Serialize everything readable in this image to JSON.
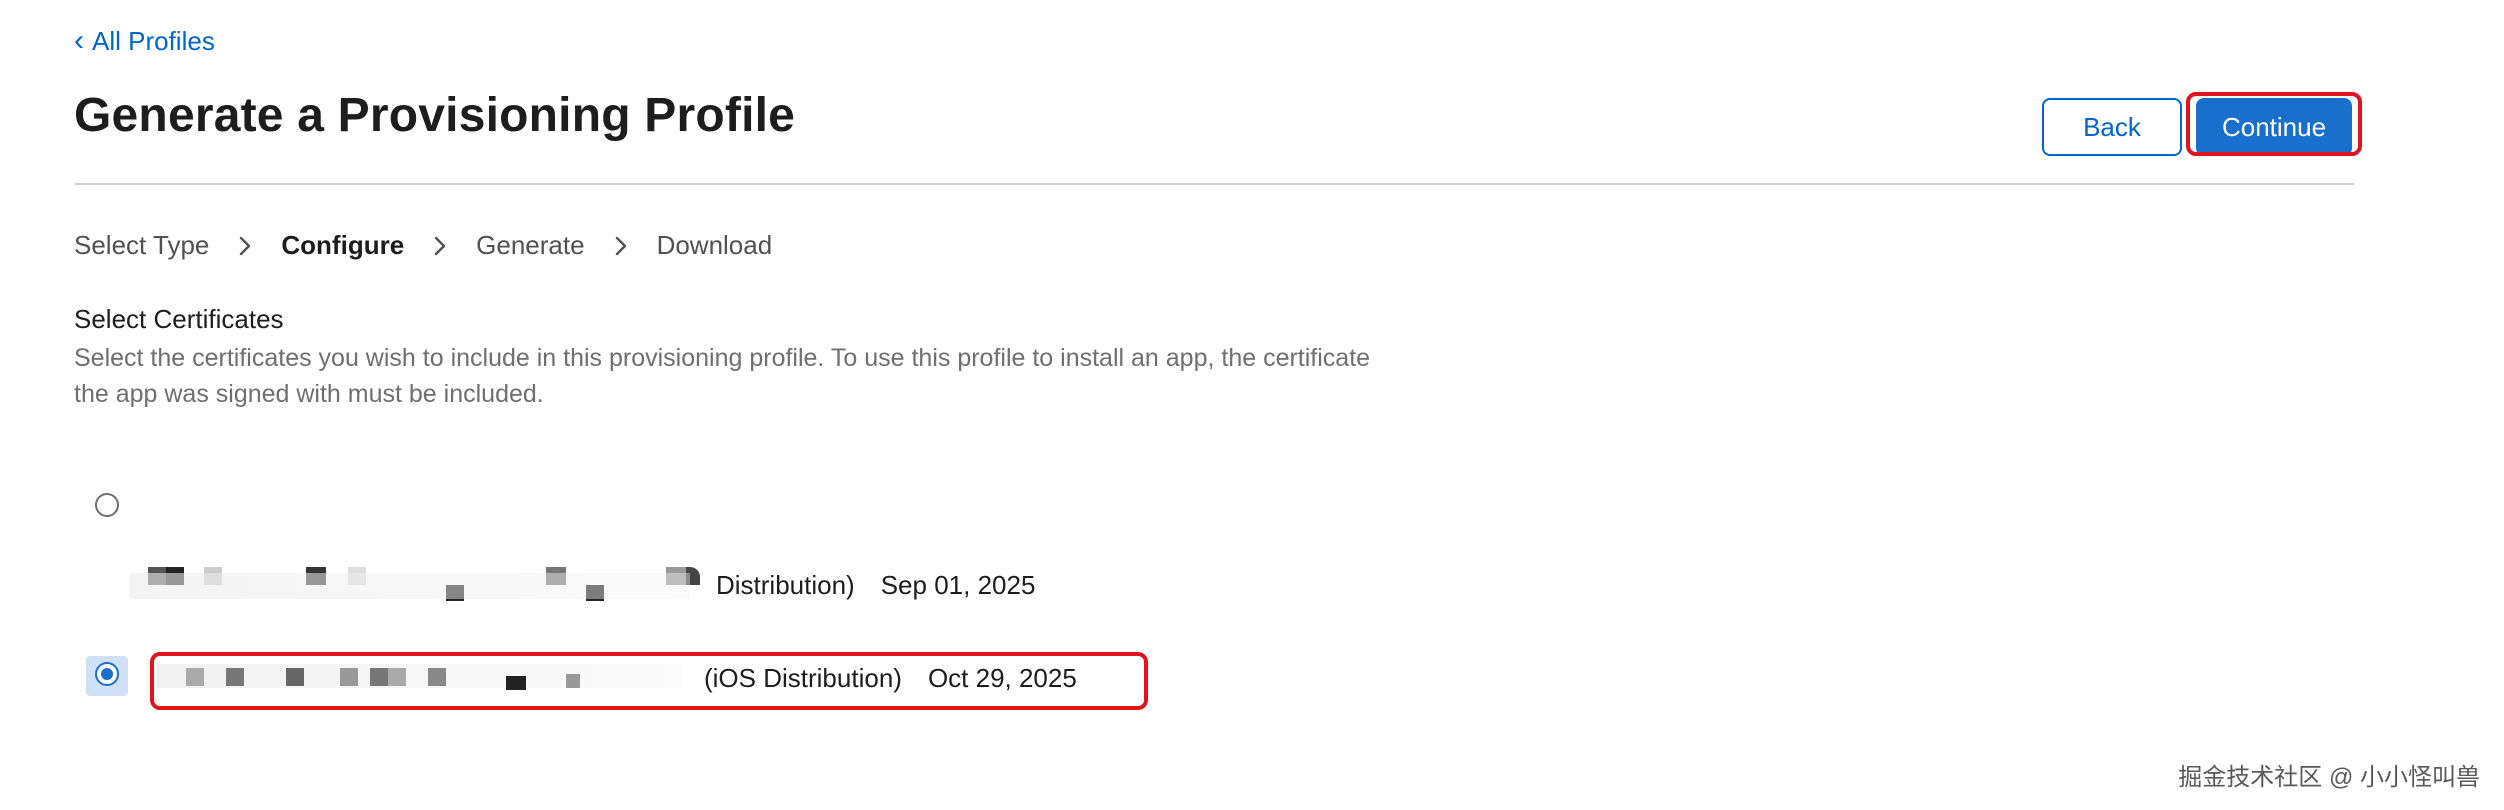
{
  "nav": {
    "back_link_chevron": "‹",
    "back_link_label": "All Profiles"
  },
  "header": {
    "title": "Generate a Provisioning Profile",
    "back_button_label": "Back",
    "continue_button_label": "Continue"
  },
  "steps": [
    {
      "label": "Select Type",
      "active": false
    },
    {
      "label": "Configure",
      "active": true
    },
    {
      "label": "Generate",
      "active": false
    },
    {
      "label": "Download",
      "active": false
    }
  ],
  "section": {
    "title": "Select Certificates",
    "description": "Select the certificates you wish to include in this provisioning profile. To use this profile to install an app, the certificate the app was signed with must be included."
  },
  "certificates": [
    {
      "name_suffix": "Distribution)",
      "date": "Sep 01, 2025",
      "selected": false
    },
    {
      "name_suffix": "(iOS Distribution)",
      "date": "Oct 29, 2025",
      "selected": true
    }
  ],
  "annotations": {
    "highlight_color": "#e0141e"
  },
  "colors": {
    "link": "#0066cc",
    "primary_button": "#1a6fcc",
    "divider": "#d2d2d7",
    "muted_text": "#6e6e73"
  },
  "watermark": "掘金技术社区 @ 小小怪叫兽"
}
